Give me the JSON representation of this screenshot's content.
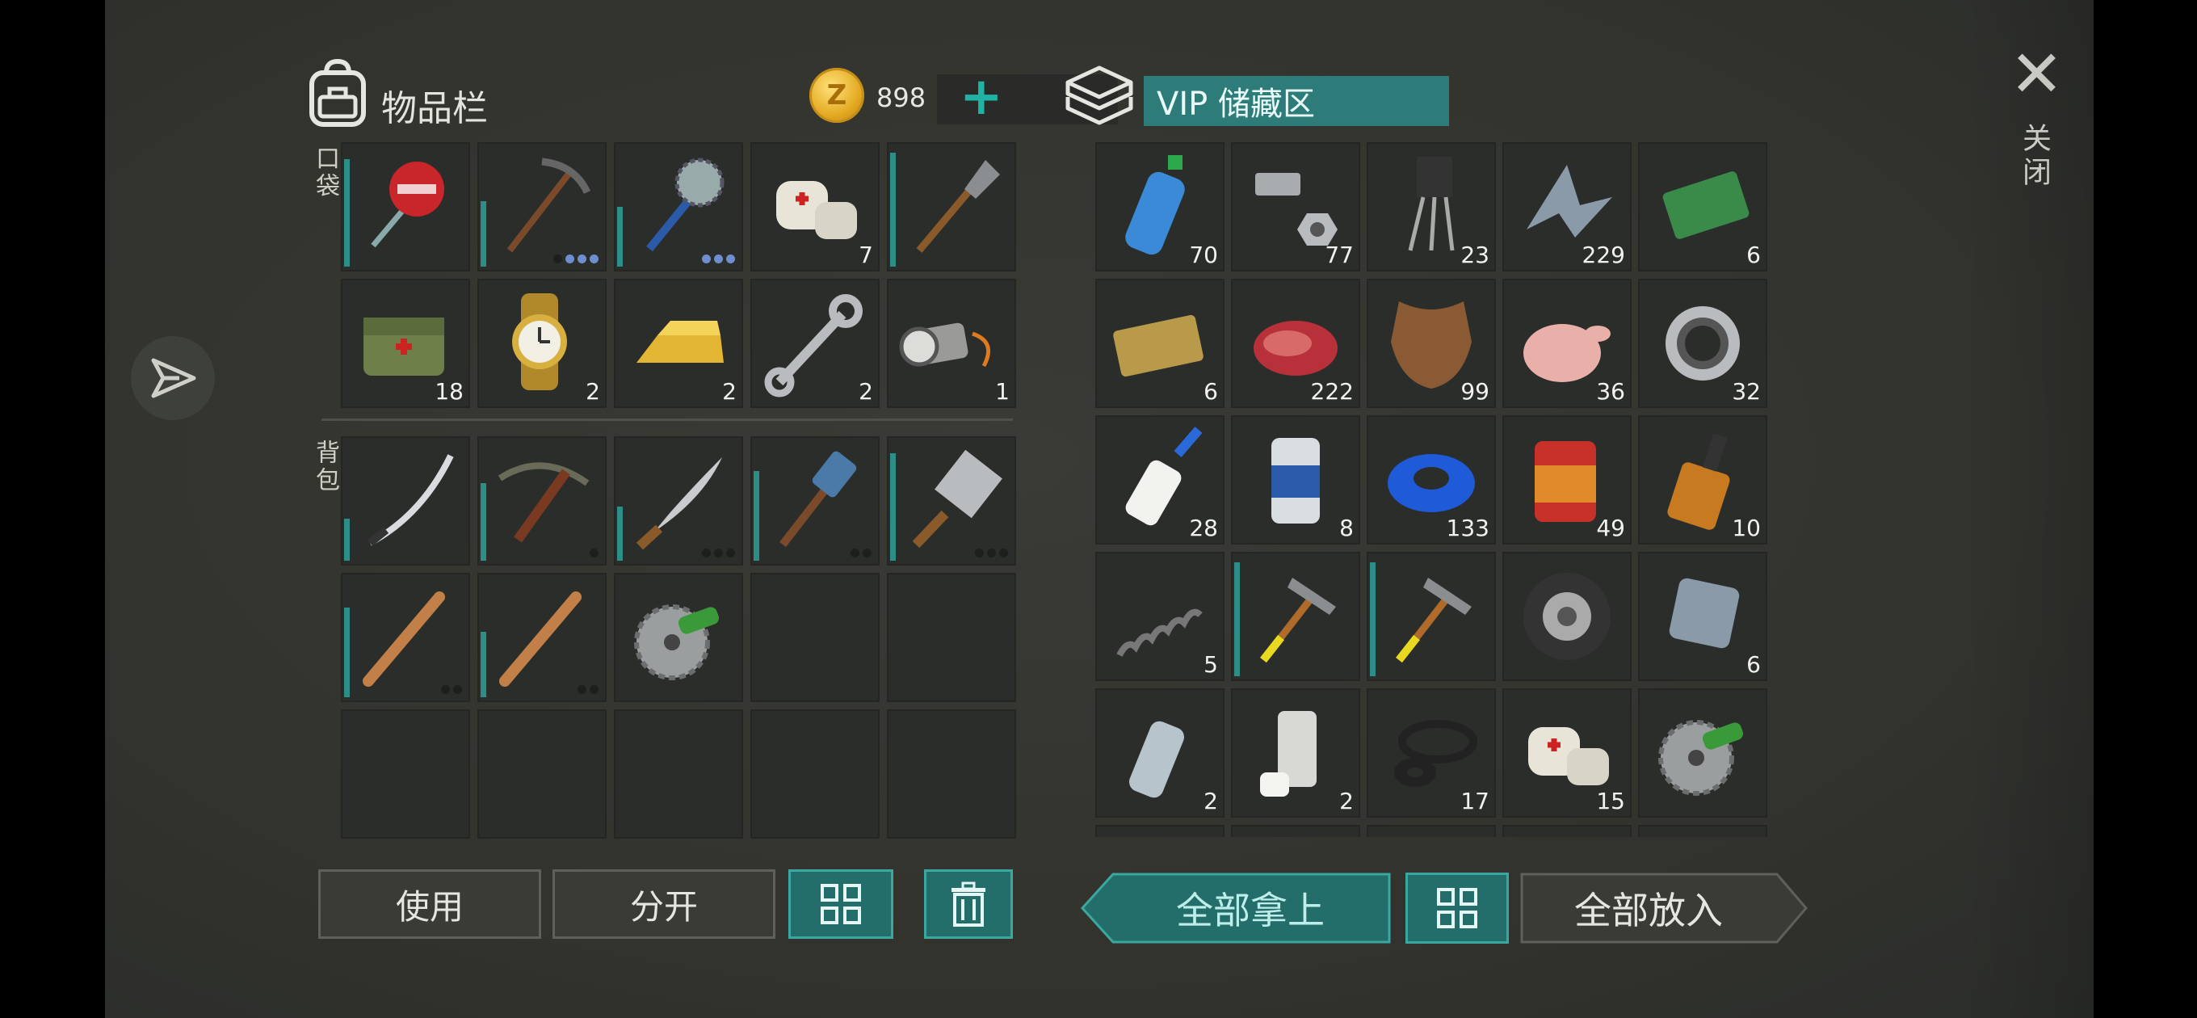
{
  "inventory": {
    "title": "物品栏",
    "coins": "898",
    "coin_symbol": "Z",
    "add_symbol": "+",
    "pocket_label": "口袋",
    "backpack_label": "背包",
    "slots": [
      {
        "icon": "stop-sign-icon",
        "count": "",
        "bar": 0.9,
        "dots": []
      },
      {
        "icon": "pickaxe-icon",
        "count": "",
        "bar": 0.55,
        "dots": [
          "d",
          "b",
          "b",
          "b"
        ]
      },
      {
        "icon": "saw-mace-icon",
        "count": "",
        "bar": 0.5,
        "dots": [
          "b",
          "b",
          "b"
        ]
      },
      {
        "icon": "bandage-icon",
        "count": "7",
        "bar": 0,
        "dots": []
      },
      {
        "icon": "shovel-icon",
        "count": "",
        "bar": 0.95,
        "dots": []
      },
      {
        "icon": "medkit-bag-icon",
        "count": "18",
        "bar": 0,
        "dots": []
      },
      {
        "icon": "wristwatch-icon",
        "count": "2",
        "bar": 0,
        "dots": []
      },
      {
        "icon": "gold-bar-icon",
        "count": "2",
        "bar": 0,
        "dots": []
      },
      {
        "icon": "wrench-icon",
        "count": "2",
        "bar": 0,
        "dots": []
      },
      {
        "icon": "flashlight-icon",
        "count": "1",
        "bar": 0,
        "dots": []
      },
      {
        "icon": "katana-icon",
        "count": "",
        "bar": 0.35,
        "dots": []
      },
      {
        "icon": "crossbow-icon",
        "count": "",
        "bar": 0.65,
        "dots": [
          "d"
        ]
      },
      {
        "icon": "machete-icon",
        "count": "",
        "bar": 0.45,
        "dots": [
          "d",
          "d",
          "d"
        ]
      },
      {
        "icon": "sledgehammer-icon",
        "count": "",
        "bar": 0.75,
        "dots": [
          "d",
          "d"
        ]
      },
      {
        "icon": "cleaver-icon",
        "count": "",
        "bar": 0.9,
        "dots": [
          "d",
          "d",
          "d"
        ]
      },
      {
        "icon": "baseball-bat-icon",
        "count": "",
        "bar": 0.75,
        "dots": [
          "d",
          "d"
        ]
      },
      {
        "icon": "baseball-bat-icon",
        "count": "",
        "bar": 0.55,
        "dots": [
          "d",
          "d"
        ]
      },
      {
        "icon": "saw-blade-icon",
        "count": "",
        "bar": 0,
        "dots": []
      },
      {
        "icon": "",
        "count": "",
        "bar": 0,
        "dots": []
      },
      {
        "icon": "",
        "count": "",
        "bar": 0,
        "dots": []
      },
      {
        "icon": "",
        "count": "",
        "bar": 0,
        "dots": []
      },
      {
        "icon": "",
        "count": "",
        "bar": 0,
        "dots": []
      },
      {
        "icon": "",
        "count": "",
        "bar": 0,
        "dots": []
      },
      {
        "icon": "",
        "count": "",
        "bar": 0,
        "dots": []
      },
      {
        "icon": "",
        "count": "",
        "bar": 0,
        "dots": []
      }
    ]
  },
  "storage": {
    "title": "VIP 储藏区",
    "slots": [
      {
        "icon": "water-bottle-icon",
        "count": "70",
        "bar": 0
      },
      {
        "icon": "bolt-nut-icon",
        "count": "77",
        "bar": 0
      },
      {
        "icon": "transistor-icon",
        "count": "23",
        "bar": 0
      },
      {
        "icon": "metal-scrap-icon",
        "count": "229",
        "bar": 0
      },
      {
        "icon": "ration-coupon-icon",
        "count": "6",
        "bar": 0
      },
      {
        "icon": "survival-coupon-icon",
        "count": "6",
        "bar": 0
      },
      {
        "icon": "steak-icon",
        "count": "222",
        "bar": 0
      },
      {
        "icon": "animal-hide-icon",
        "count": "99",
        "bar": 0
      },
      {
        "icon": "raw-chicken-icon",
        "count": "36",
        "bar": 0
      },
      {
        "icon": "bearing-icon",
        "count": "32",
        "bar": 0
      },
      {
        "icon": "glue-icon",
        "count": "28",
        "bar": 0
      },
      {
        "icon": "beer-can-icon",
        "count": "8",
        "bar": 0
      },
      {
        "icon": "blue-tape-icon",
        "count": "133",
        "bar": 0
      },
      {
        "icon": "canned-food-icon",
        "count": "49",
        "bar": 0
      },
      {
        "icon": "whiskey-icon",
        "count": "10",
        "bar": 0
      },
      {
        "icon": "spring-icon",
        "count": "5",
        "bar": 0
      },
      {
        "icon": "hammer-icon",
        "count": "",
        "bar": 0.95
      },
      {
        "icon": "hammer-icon",
        "count": "",
        "bar": 0.95
      },
      {
        "icon": "tire-icon",
        "count": "",
        "bar": 0
      },
      {
        "icon": "metal-plate-icon",
        "count": "6",
        "bar": 0
      },
      {
        "icon": "empty-bottle-icon",
        "count": "2",
        "bar": 0
      },
      {
        "icon": "spray-paint-icon",
        "count": "2",
        "bar": 0
      },
      {
        "icon": "rubber-seal-icon",
        "count": "17",
        "bar": 0
      },
      {
        "icon": "bandage-icon",
        "count": "15",
        "bar": 0
      },
      {
        "icon": "saw-blade-icon",
        "count": "",
        "bar": 0
      }
    ]
  },
  "buttons": {
    "use": "使用",
    "split": "分开",
    "take_all": "全部拿上",
    "put_all": "全部放入"
  },
  "close": {
    "symbol": "✕",
    "label": "关闭"
  },
  "colors": {
    "accent": "#2d8d87",
    "panel": "#2b2d2b"
  }
}
